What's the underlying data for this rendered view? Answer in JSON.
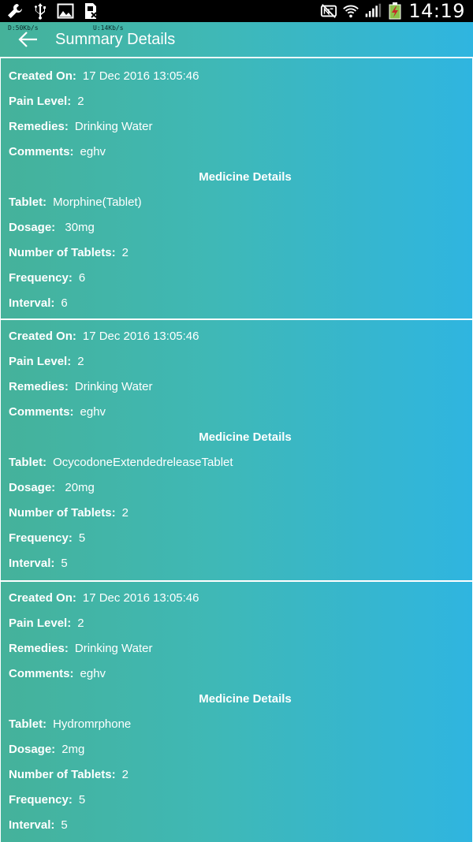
{
  "status_bar": {
    "time": "14:19",
    "net_down": "D:50Kb/s",
    "net_up": "U:14Kb/s"
  },
  "app_bar": {
    "title": "Summary Details"
  },
  "labels": {
    "created_on": "Created On:",
    "pain_level": "Pain Level:",
    "remedies": "Remedies:",
    "comments": "Comments:",
    "medicine_details": "Medicine Details",
    "tablet": "Tablet:",
    "dosage": "Dosage:",
    "number_of_tablets": "Number of Tablets:",
    "frequency": "Frequency:",
    "interval": "Interval:"
  },
  "records": [
    {
      "created_on": "17 Dec 2016 13:05:46",
      "pain_level": "2",
      "remedies": "Drinking Water",
      "comments": "eghv",
      "tablet": "Morphine(Tablet)",
      "dosage": " 30mg",
      "number_of_tablets": "2",
      "frequency": "6",
      "interval": "6"
    },
    {
      "created_on": "17 Dec 2016 13:05:46",
      "pain_level": "2",
      "remedies": "Drinking Water",
      "comments": "eghv",
      "tablet": "OcycodoneExtendedreleaseTablet",
      "dosage": " 20mg",
      "number_of_tablets": "2",
      "frequency": "5",
      "interval": "5"
    },
    {
      "created_on": "17 Dec 2016 13:05:46",
      "pain_level": "2",
      "remedies": "Drinking Water",
      "comments": "eghv",
      "tablet": "Hydromrphone",
      "dosage": "2mg",
      "number_of_tablets": "2",
      "frequency": "5",
      "interval": "5"
    }
  ]
}
